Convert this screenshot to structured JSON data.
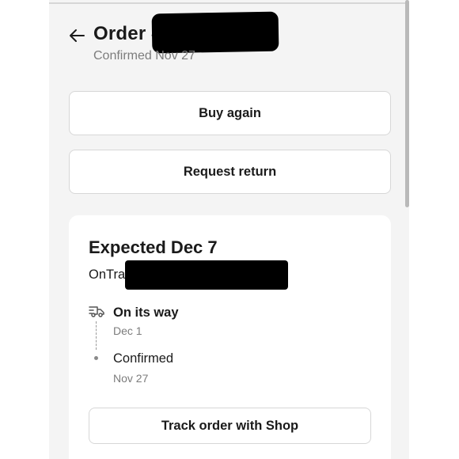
{
  "header": {
    "title": "Order #",
    "subtitle": "Confirmed Nov 27"
  },
  "actions": {
    "buy_again": "Buy again",
    "request_return": "Request return"
  },
  "shipment": {
    "expected": "Expected Dec 7",
    "carrier": "OnTrac",
    "timeline": [
      {
        "status": "On its way",
        "date": "Dec 1",
        "icon": "truck-icon"
      },
      {
        "status": "Confirmed",
        "date": "Nov 27",
        "icon": "dot-icon"
      }
    ],
    "track_label": "Track order with Shop"
  }
}
